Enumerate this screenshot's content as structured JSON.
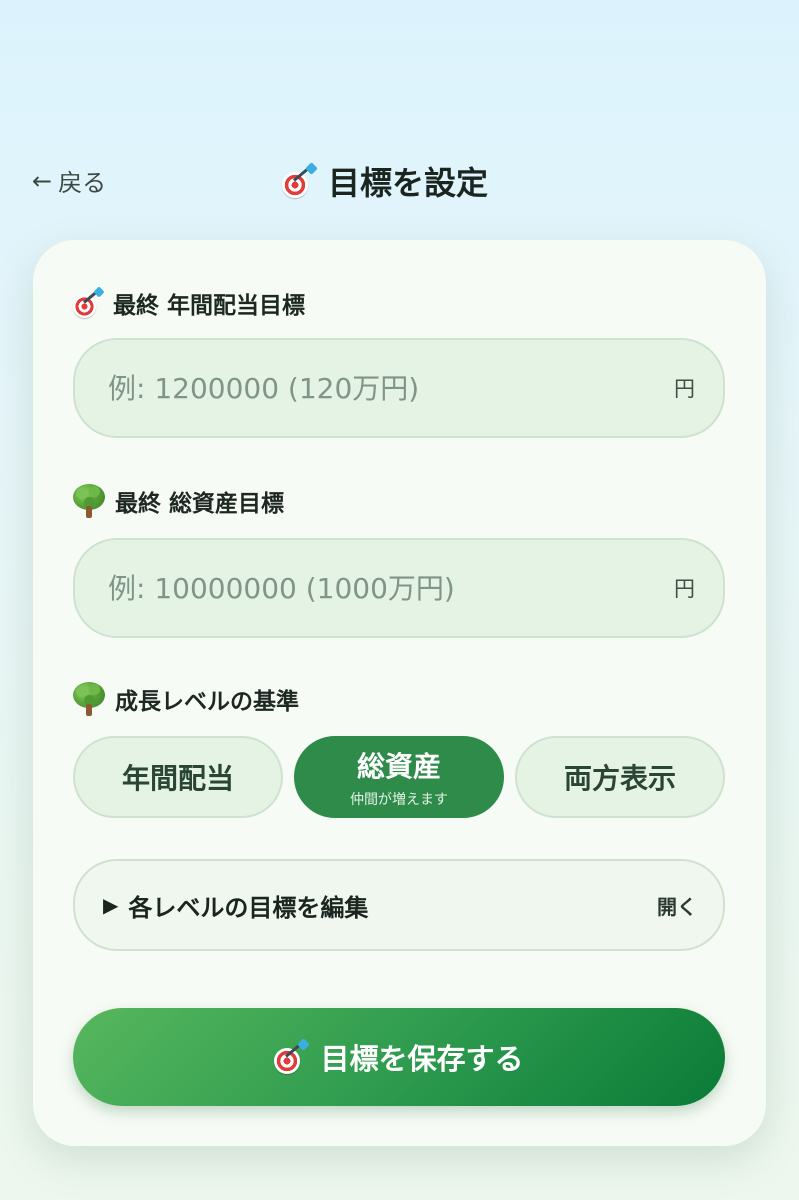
{
  "header": {
    "back_label": "戻る",
    "title": "目標を設定"
  },
  "annual_dividend": {
    "label": "最終 年間配当目標",
    "placeholder": "例: 1200000 (120万円)",
    "value": "",
    "unit": "円"
  },
  "total_assets": {
    "label": "最終 総資産目標",
    "placeholder": "例: 10000000 (1000万円)",
    "value": "",
    "unit": "円"
  },
  "growth_level": {
    "label": "成長レベルの基準",
    "options": [
      {
        "label": "年間配当",
        "sub": ""
      },
      {
        "label": "総資産",
        "sub": "仲間が増えます"
      },
      {
        "label": "両方表示",
        "sub": ""
      }
    ],
    "selected": "総資産"
  },
  "level_edit": {
    "label": "各レベルの目標を編集",
    "toggle_label": "開く",
    "expanded": false
  },
  "save_button": {
    "label": "目標を保存する"
  },
  "icons": {
    "back": "arrow-left-icon",
    "target": "target-dart-icon",
    "tree": "tree-icon",
    "expand": "triangle-right-icon"
  },
  "colors": {
    "accent": "#2e8b4a",
    "input_bg": "#e4f3e3",
    "save_gradient_start": "#57b75d",
    "save_gradient_end": "#0a7b37"
  }
}
